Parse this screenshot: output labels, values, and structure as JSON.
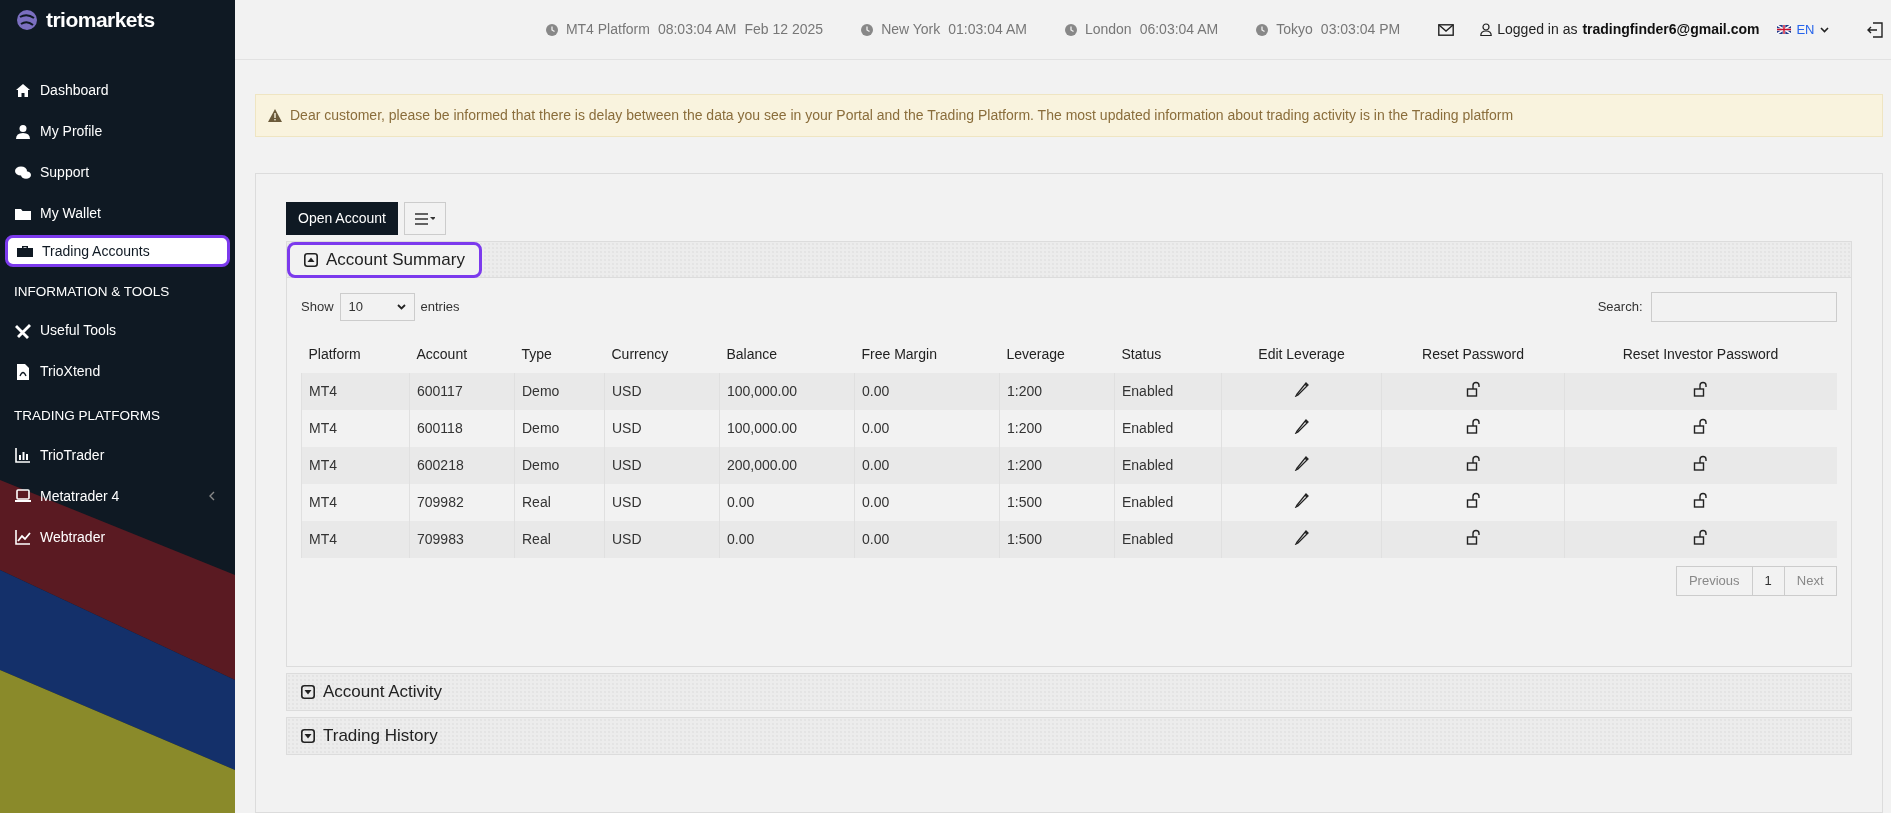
{
  "sidebar": {
    "brand": "triomarkets",
    "sections": [
      {
        "items": [
          {
            "label": "Dashboard",
            "kind": "link",
            "selected": false
          },
          {
            "label": "My Profile",
            "kind": "link",
            "selected": false
          },
          {
            "label": "Support",
            "kind": "link",
            "selected": false
          },
          {
            "label": "My Wallet",
            "kind": "link",
            "selected": false
          },
          {
            "label": "Trading Accounts",
            "kind": "link",
            "selected": true
          }
        ]
      },
      {
        "heading": "INFORMATION & TOOLS",
        "items": [
          {
            "label": "Useful Tools",
            "kind": "link",
            "selected": false
          },
          {
            "label": "TrioXtend",
            "kind": "link",
            "selected": false
          }
        ]
      },
      {
        "heading": "TRADING PLATFORMS",
        "items": [
          {
            "label": "TrioTrader",
            "kind": "link",
            "selected": false
          },
          {
            "label": "Metatrader 4",
            "kind": "group",
            "selected": false
          },
          {
            "label": "Webtrader",
            "kind": "link",
            "selected": false
          }
        ]
      }
    ]
  },
  "header": {
    "clocks": [
      {
        "label": "MT4 Platform",
        "time": "08:03:04 AM",
        "date": "Feb 12 2025"
      },
      {
        "label": "New York",
        "time": "01:03:04 AM"
      },
      {
        "label": "London",
        "time": "06:03:04 AM"
      },
      {
        "label": "Tokyo",
        "time": "03:03:04 PM"
      }
    ],
    "login_prefix": "Logged in as",
    "login_user": "tradingfinder6@gmail.com",
    "language": "EN"
  },
  "notice": "Dear customer, please be informed that there is delay between the data you see in your Portal and the Trading Platform. The most updated information about trading activity is in the Trading platform",
  "toolbar": {
    "open_account": "Open Account"
  },
  "panels": [
    {
      "title": "Account Summary",
      "expanded": true,
      "highlighted": true
    },
    {
      "title": "Account Activity",
      "expanded": false,
      "highlighted": false
    },
    {
      "title": "Trading History",
      "expanded": false,
      "highlighted": false
    }
  ],
  "table": {
    "show_label": "Show",
    "page_size": "10",
    "entries_label": "entries",
    "search_label": "Search:",
    "columns": [
      "Platform",
      "Account",
      "Type",
      "Currency",
      "Balance",
      "Free Margin",
      "Leverage",
      "Status",
      "Edit Leverage",
      "Reset Password",
      "Reset Investor Password"
    ],
    "rows": [
      [
        "MT4",
        "600117",
        "Demo",
        "USD",
        "100,000.00",
        "0.00",
        "1:200",
        "Enabled"
      ],
      [
        "MT4",
        "600118",
        "Demo",
        "USD",
        "100,000.00",
        "0.00",
        "1:200",
        "Enabled"
      ],
      [
        "MT4",
        "600218",
        "Demo",
        "USD",
        "200,000.00",
        "0.00",
        "1:200",
        "Enabled"
      ],
      [
        "MT4",
        "709982",
        "Real",
        "USD",
        "0.00",
        "0.00",
        "1:500",
        "Enabled"
      ],
      [
        "MT4",
        "709983",
        "Real",
        "USD",
        "0.00",
        "0.00",
        "1:500",
        "Enabled"
      ]
    ],
    "pagination": [
      {
        "label": "Previous",
        "selected": false
      },
      {
        "label": "1",
        "selected": true
      },
      {
        "label": "Next",
        "selected": false
      }
    ]
  }
}
